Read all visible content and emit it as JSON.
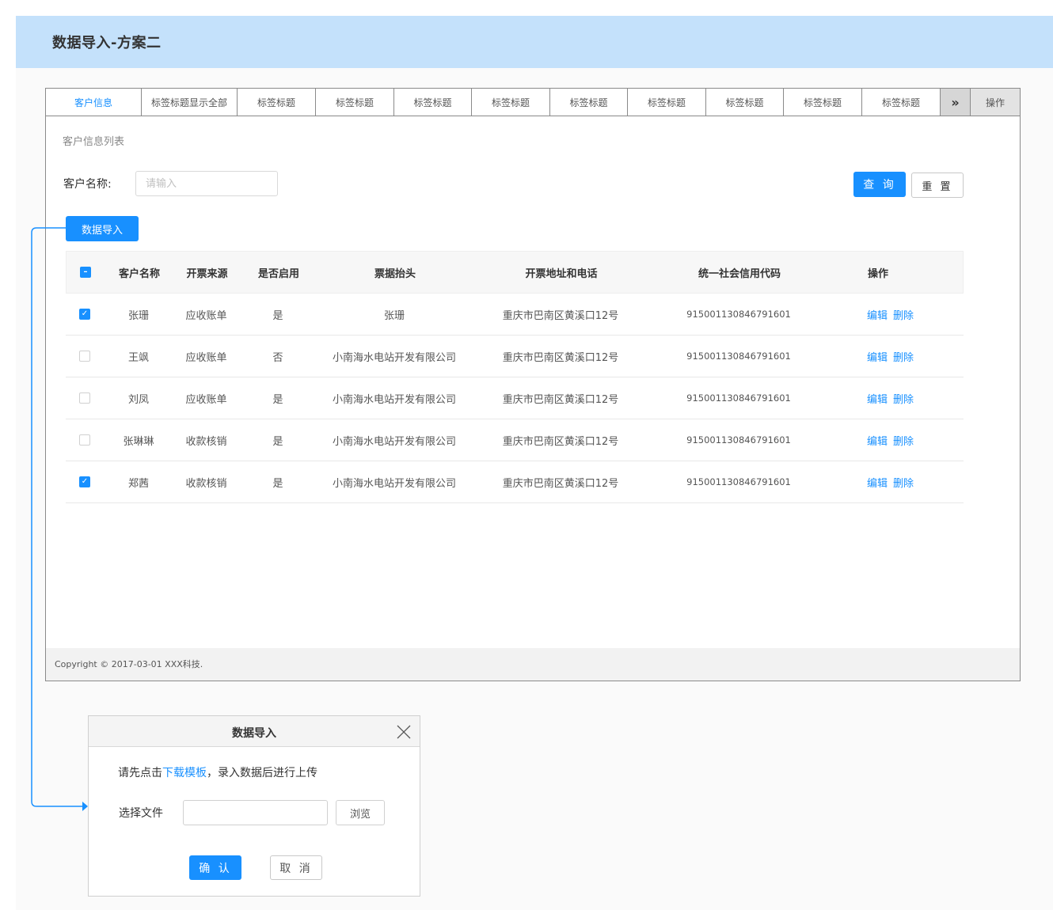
{
  "page": {
    "title": "数据导入-方案二"
  },
  "tabs": [
    {
      "label": "客户信息",
      "active": true
    },
    {
      "label": "标签标题显示全部"
    },
    {
      "label": "标签标题"
    },
    {
      "label": "标签标题"
    },
    {
      "label": "标签标题"
    },
    {
      "label": "标签标题"
    },
    {
      "label": "标签标题"
    },
    {
      "label": "标签标题"
    },
    {
      "label": "标签标题"
    },
    {
      "label": "标签标题"
    },
    {
      "label": "标签标题"
    },
    {
      "label": "»",
      "icon": "double-chevron-right-icon"
    },
    {
      "label": "操作"
    }
  ],
  "list": {
    "title": "客户信息列表"
  },
  "search": {
    "label": "客户名称:",
    "placeholder": "请输入",
    "query_label": "查 询",
    "reset_label": "重 置"
  },
  "import_button": "数据导入",
  "table": {
    "headers": {
      "name": "客户名称",
      "source": "开票来源",
      "enabled": "是否启用",
      "invoice_title": "票据抬头",
      "address": "开票地址和电话",
      "credit_code": "统一社会信用代码",
      "actions": "操作"
    },
    "header_checkbox": "partial",
    "rows": [
      {
        "checked": true,
        "name": "张珊",
        "source": "应收账单",
        "enabled": "是",
        "invoice_title": "张珊",
        "address": "重庆市巴南区黄溪口12号",
        "credit_code": "915001130846791601",
        "edit": "编辑",
        "delete": "删除"
      },
      {
        "checked": false,
        "name": "王飒",
        "source": "应收账单",
        "enabled": "否",
        "invoice_title": "小南海水电站开发有限公司",
        "address": "重庆市巴南区黄溪口12号",
        "credit_code": "915001130846791601",
        "edit": "编辑",
        "delete": "删除"
      },
      {
        "checked": false,
        "name": "刘凤",
        "source": "应收账单",
        "enabled": "是",
        "invoice_title": "小南海水电站开发有限公司",
        "address": "重庆市巴南区黄溪口12号",
        "credit_code": "915001130846791601",
        "edit": "编辑",
        "delete": "删除"
      },
      {
        "checked": false,
        "name": "张琳琳",
        "source": "收款核销",
        "enabled": "是",
        "invoice_title": "小南海水电站开发有限公司",
        "address": "重庆市巴南区黄溪口12号",
        "credit_code": "915001130846791601",
        "edit": "编辑",
        "delete": "删除"
      },
      {
        "checked": true,
        "name": "郑茜",
        "source": "收款核销",
        "enabled": "是",
        "invoice_title": "小南海水电站开发有限公司",
        "address": "重庆市巴南区黄溪口12号",
        "credit_code": "915001130846791601",
        "edit": "编辑",
        "delete": "删除"
      }
    ]
  },
  "footer": {
    "copyright": "Copyright © 2017-03-01 XXX科技."
  },
  "dialog": {
    "title": "数据导入",
    "tip_before": "请先点击",
    "tip_link": "下载模板",
    "tip_after": "，录入数据后进行上传",
    "file_label": "选择文件",
    "file_value": "",
    "browse_label": "浏览",
    "ok_label": "确 认",
    "cancel_label": "取 消"
  },
  "colors": {
    "primary": "#1890ff",
    "header_bg": "#c4e1fb",
    "connector": "#1890ff"
  }
}
